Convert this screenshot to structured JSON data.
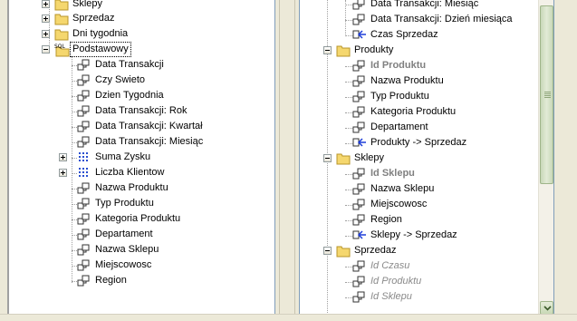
{
  "left_tree": {
    "folders": [
      {
        "label": "Sklepy"
      },
      {
        "label": "Sprzedaz"
      },
      {
        "label": "Dni tygodnia"
      }
    ],
    "perspective": {
      "label": "Podstawowy",
      "icon_badge": "SQL"
    },
    "items": [
      {
        "label": "Data Transakcji",
        "icon": "field-icon"
      },
      {
        "label": "Czy Swieto",
        "icon": "field-icon"
      },
      {
        "label": "Dzien Tygodnia",
        "icon": "field-icon"
      },
      {
        "label": "Data Transakcji: Rok",
        "icon": "field-icon"
      },
      {
        "label": "Data Transakcji: Kwartał",
        "icon": "field-icon"
      },
      {
        "label": "Data Transakcji: Miesiąc",
        "icon": "field-icon"
      },
      {
        "label": "Suma Zysku",
        "icon": "measure-icon"
      },
      {
        "label": "Liczba Klientow",
        "icon": "measure-icon"
      },
      {
        "label": "Nazwa Produktu",
        "icon": "field-icon"
      },
      {
        "label": "Typ Produktu",
        "icon": "field-icon"
      },
      {
        "label": "Kategoria Produktu",
        "icon": "field-icon"
      },
      {
        "label": "Departament",
        "icon": "field-icon"
      },
      {
        "label": "Nazwa Sklepu",
        "icon": "field-icon"
      },
      {
        "label": "Miejscowosc",
        "icon": "field-icon"
      },
      {
        "label": "Region",
        "icon": "field-icon"
      }
    ]
  },
  "right_tree": {
    "top_items": [
      {
        "label": "Data Transakcji: Miesiąc",
        "icon": "field-icon"
      },
      {
        "label": "Data Transakcji: Dzień miesiąca",
        "icon": "field-icon"
      },
      {
        "label": "Czas Sprzedaz",
        "icon": "relation-icon"
      }
    ],
    "tables": [
      {
        "label": "Produkty",
        "items": [
          {
            "label": "Id Produktu",
            "style": "key"
          },
          {
            "label": "Nazwa Produktu",
            "style": "normal"
          },
          {
            "label": "Typ Produktu",
            "style": "normal"
          },
          {
            "label": "Kategoria Produktu",
            "style": "normal"
          },
          {
            "label": "Departament",
            "style": "normal"
          },
          {
            "label": "Produkty -> Sprzedaz",
            "style": "relation"
          }
        ]
      },
      {
        "label": "Sklepy",
        "items": [
          {
            "label": "Id Sklepu",
            "style": "key"
          },
          {
            "label": "Nazwa Sklepu",
            "style": "normal"
          },
          {
            "label": "Miejscowosc",
            "style": "normal"
          },
          {
            "label": "Region",
            "style": "normal"
          },
          {
            "label": "Sklepy -> Sprzedaz",
            "style": "relation"
          }
        ]
      },
      {
        "label": "Sprzedaz",
        "items": [
          {
            "label": "Id Czasu",
            "style": "foreign"
          },
          {
            "label": "Id Produktu",
            "style": "foreign"
          },
          {
            "label": "Id Sklepu",
            "style": "foreign"
          }
        ]
      }
    ]
  },
  "colors": {
    "folder": "#f5d76e",
    "relation_arrow": "#1f3fd8",
    "key_text": "#808080",
    "scroll_thumb": "#c8d8b8"
  }
}
